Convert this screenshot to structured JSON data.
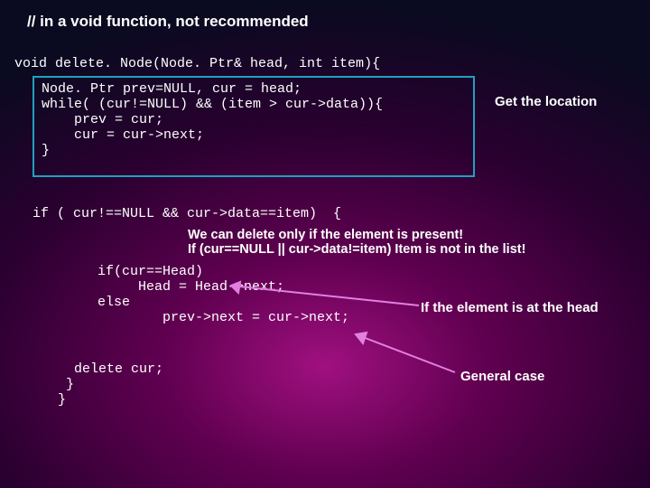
{
  "title": "// in a void function, not recommended",
  "sig": "void delete. Node(Node. Ptr& head, int item){",
  "box": "Node. Ptr prev=NULL, cur = head;\nwhile( (cur!=NULL) && (item > cur->data)){\n    prev = cur;\n    cur = cur->next;\n}",
  "label_get": "Get the location",
  "ifline": "if ( cur!==NULL && cur->data==item)  {",
  "we_can_l1": "We can delete only if the element is present!",
  "we_can_l2": "If (cur==NULL || cur->data!=item) Item is not in the list!",
  "ifhead": "if(cur==Head)\n     Head = Head->next;\nelse\n        prev->next = cur->next;",
  "label_head": "If the element is at the head",
  "delcur": "  delete cur;\n }\n}",
  "label_gen": "General case"
}
